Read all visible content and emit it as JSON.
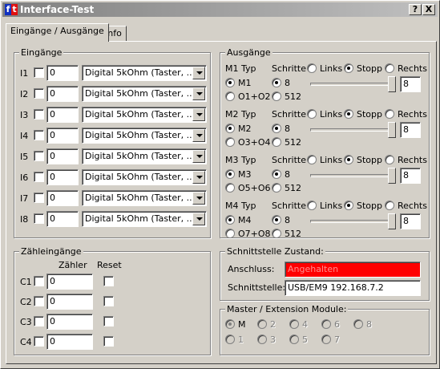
{
  "window": {
    "title": "Interface-Test",
    "help_label": "?",
    "close_label": "X"
  },
  "tabs": [
    {
      "label": "Eingänge / Ausgänge"
    },
    {
      "label": "Info"
    }
  ],
  "eingaenge": {
    "title": "Eingänge",
    "rows": [
      {
        "label": "I1",
        "value": "0",
        "mode": "Digital 5kOhm (Taster, ...)"
      },
      {
        "label": "I2",
        "value": "0",
        "mode": "Digital 5kOhm (Taster, ...)"
      },
      {
        "label": "I3",
        "value": "0",
        "mode": "Digital 5kOhm (Taster, ...)"
      },
      {
        "label": "I4",
        "value": "0",
        "mode": "Digital 5kOhm (Taster, ...)"
      },
      {
        "label": "I5",
        "value": "0",
        "mode": "Digital 5kOhm (Taster, ...)"
      },
      {
        "label": "I6",
        "value": "0",
        "mode": "Digital 5kOhm (Taster, ...)"
      },
      {
        "label": "I7",
        "value": "0",
        "mode": "Digital 5kOhm (Taster, ...)"
      },
      {
        "label": "I8",
        "value": "0",
        "mode": "Digital 5kOhm (Taster, ...)"
      }
    ]
  },
  "ausgaenge": {
    "title": "Ausgänge",
    "motors": [
      {
        "typ_label": "M1 Typ",
        "schritte_label": "Schritte",
        "opt_a": "M1",
        "opt_b": "O1+O2",
        "step_a": "8",
        "step_b": "512",
        "links": "Links",
        "stopp": "Stopp",
        "rechts": "Rechts",
        "speed": "8",
        "speed_fraction": 1.0
      },
      {
        "typ_label": "M2 Typ",
        "schritte_label": "Schritte",
        "opt_a": "M2",
        "opt_b": "O3+O4",
        "step_a": "8",
        "step_b": "512",
        "links": "Links",
        "stopp": "Stopp",
        "rechts": "Rechts",
        "speed": "8",
        "speed_fraction": 1.0
      },
      {
        "typ_label": "M3 Typ",
        "schritte_label": "Schritte",
        "opt_a": "M3",
        "opt_b": "O5+O6",
        "step_a": "8",
        "step_b": "512",
        "links": "Links",
        "stopp": "Stopp",
        "rechts": "Rechts",
        "speed": "8",
        "speed_fraction": 1.0
      },
      {
        "typ_label": "M4 Typ",
        "schritte_label": "Schritte",
        "opt_a": "M4",
        "opt_b": "O7+O8",
        "step_a": "8",
        "step_b": "512",
        "links": "Links",
        "stopp": "Stopp",
        "rechts": "Rechts",
        "speed": "8",
        "speed_fraction": 1.0
      }
    ]
  },
  "zaehler": {
    "title": "Zähleingänge",
    "col_zaehler": "Zähler",
    "col_reset": "Reset",
    "rows": [
      {
        "label": "C1",
        "value": "0"
      },
      {
        "label": "C2",
        "value": "0"
      },
      {
        "label": "C3",
        "value": "0"
      },
      {
        "label": "C4",
        "value": "0"
      }
    ]
  },
  "schnittstelle": {
    "title": "Schnittstelle Zustand:",
    "anschluss_label": "Anschluss:",
    "anschluss_value": "Angehalten",
    "anschluss_color": "#ff0000",
    "schnittstelle_label": "Schnittstelle:",
    "schnittstelle_value": "USB/EM9 192.168.7.2"
  },
  "module": {
    "title": "Master / Extension Module:",
    "options": [
      "M",
      "2",
      "4",
      "6",
      "8",
      "1",
      "3",
      "5",
      "7"
    ],
    "selected": "M"
  }
}
